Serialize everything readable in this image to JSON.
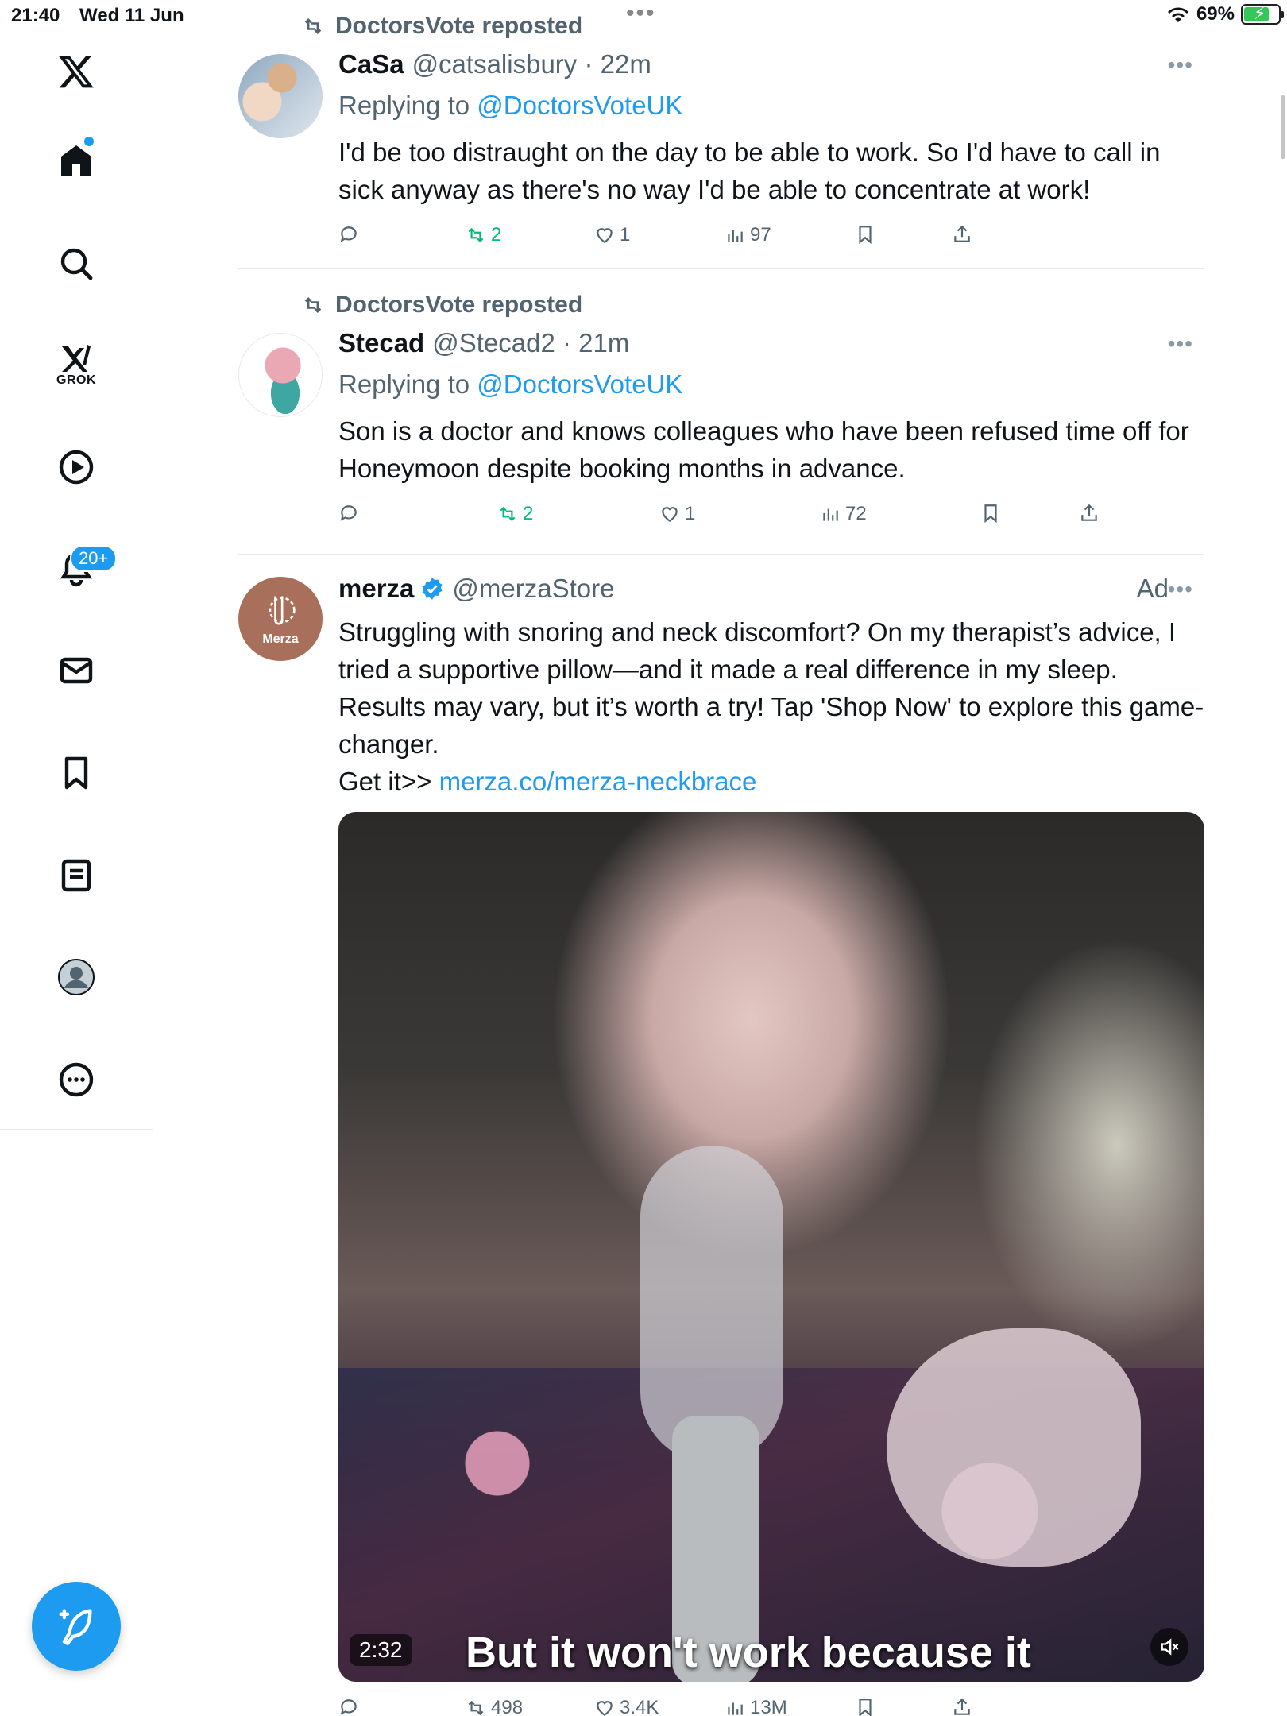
{
  "status_bar": {
    "time": "21:40",
    "date": "Wed 11 Jun",
    "battery": "69%",
    "battery_level": 0.69
  },
  "sidebar": {
    "grok_label": "GROK",
    "notifications_badge": "20+"
  },
  "posts": [
    {
      "repost_label": "DoctorsVote reposted",
      "name": "CaSa",
      "meta": "@catsalisbury · 22m",
      "reply_prefix": "Replying to",
      "reply_to": "@DoctorsVoteUK",
      "body": "I'd be too distraught on the day to be able to work. So I'd have to call in sick anyway as there's no way I'd be able to concentrate at work!",
      "reposts": "2",
      "likes": "1",
      "views": "97"
    },
    {
      "repost_label": "DoctorsVote reposted",
      "name": "Stecad",
      "meta": "@Stecad2 · 21m",
      "reply_prefix": "Replying to",
      "reply_to": "@DoctorsVoteUK",
      "body": "Son is a doctor and knows colleagues who have been refused time off for Honeymoon despite booking months in advance.",
      "reposts": "2",
      "likes": "1",
      "views": "72"
    },
    {
      "name": "merza",
      "meta": "@merzaStore",
      "ad_label": "Ad",
      "avatar_label": "Merza",
      "body": "Struggling with snoring and neck discomfort? On my therapist’s advice, I tried a supportive pillow—and it made a real difference in my sleep. Results may vary, but it’s worth a try! Tap 'Shop Now' to explore this game-changer.",
      "link_prefix": "Get it>>",
      "link": "merza.co/merza-neckbrace",
      "video_duration": "2:32",
      "video_caption": "But it won't work because it",
      "reposts": "498",
      "likes": "3.4K",
      "views": "13M"
    }
  ],
  "colors": {
    "accent": "#1d9bf0",
    "repost_green": "#00ba7c",
    "muted": "#536471"
  }
}
